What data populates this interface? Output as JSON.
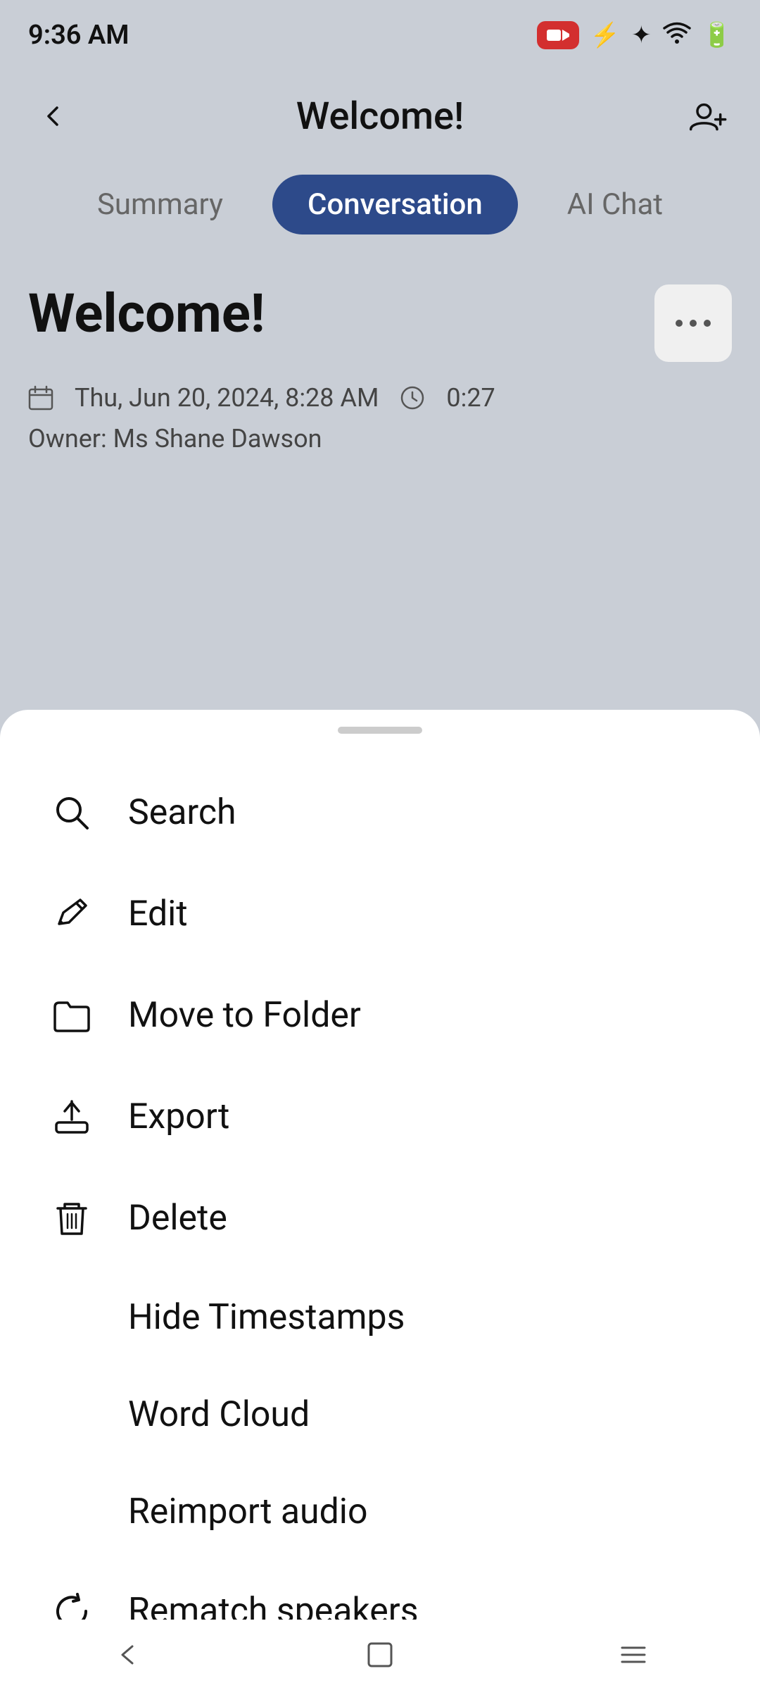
{
  "statusBar": {
    "time": "9:36 AM"
  },
  "header": {
    "title": "Welcome!",
    "backLabel": "back",
    "addPersonLabel": "add person"
  },
  "tabs": [
    {
      "id": "summary",
      "label": "Summary",
      "active": false
    },
    {
      "id": "conversation",
      "label": "Conversation",
      "active": true
    },
    {
      "id": "ai-chat",
      "label": "AI Chat",
      "active": false
    }
  ],
  "meeting": {
    "title": "Welcome!",
    "date": "Thu, Jun 20, 2024, 8:28 AM",
    "duration": "0:27",
    "owner": "Owner: Ms Shane Dawson"
  },
  "bottomSheet": {
    "handleLabel": "drag handle",
    "menuItems": [
      {
        "id": "search",
        "label": "Search",
        "icon": "search"
      },
      {
        "id": "edit",
        "label": "Edit",
        "icon": "edit"
      },
      {
        "id": "move-to-folder",
        "label": "Move to Folder",
        "icon": "folder"
      },
      {
        "id": "export",
        "label": "Export",
        "icon": "export"
      },
      {
        "id": "delete",
        "label": "Delete",
        "icon": "trash"
      },
      {
        "id": "hide-timestamps",
        "label": "Hide Timestamps",
        "icon": "none"
      },
      {
        "id": "word-cloud",
        "label": "Word Cloud",
        "icon": "none"
      },
      {
        "id": "reimport-audio",
        "label": "Reimport audio",
        "icon": "none"
      },
      {
        "id": "rematch-speakers",
        "label": "Rematch speakers",
        "icon": "refresh"
      }
    ]
  },
  "navBar": {
    "back": "back navigation",
    "home": "home navigation",
    "menu": "menu navigation"
  }
}
